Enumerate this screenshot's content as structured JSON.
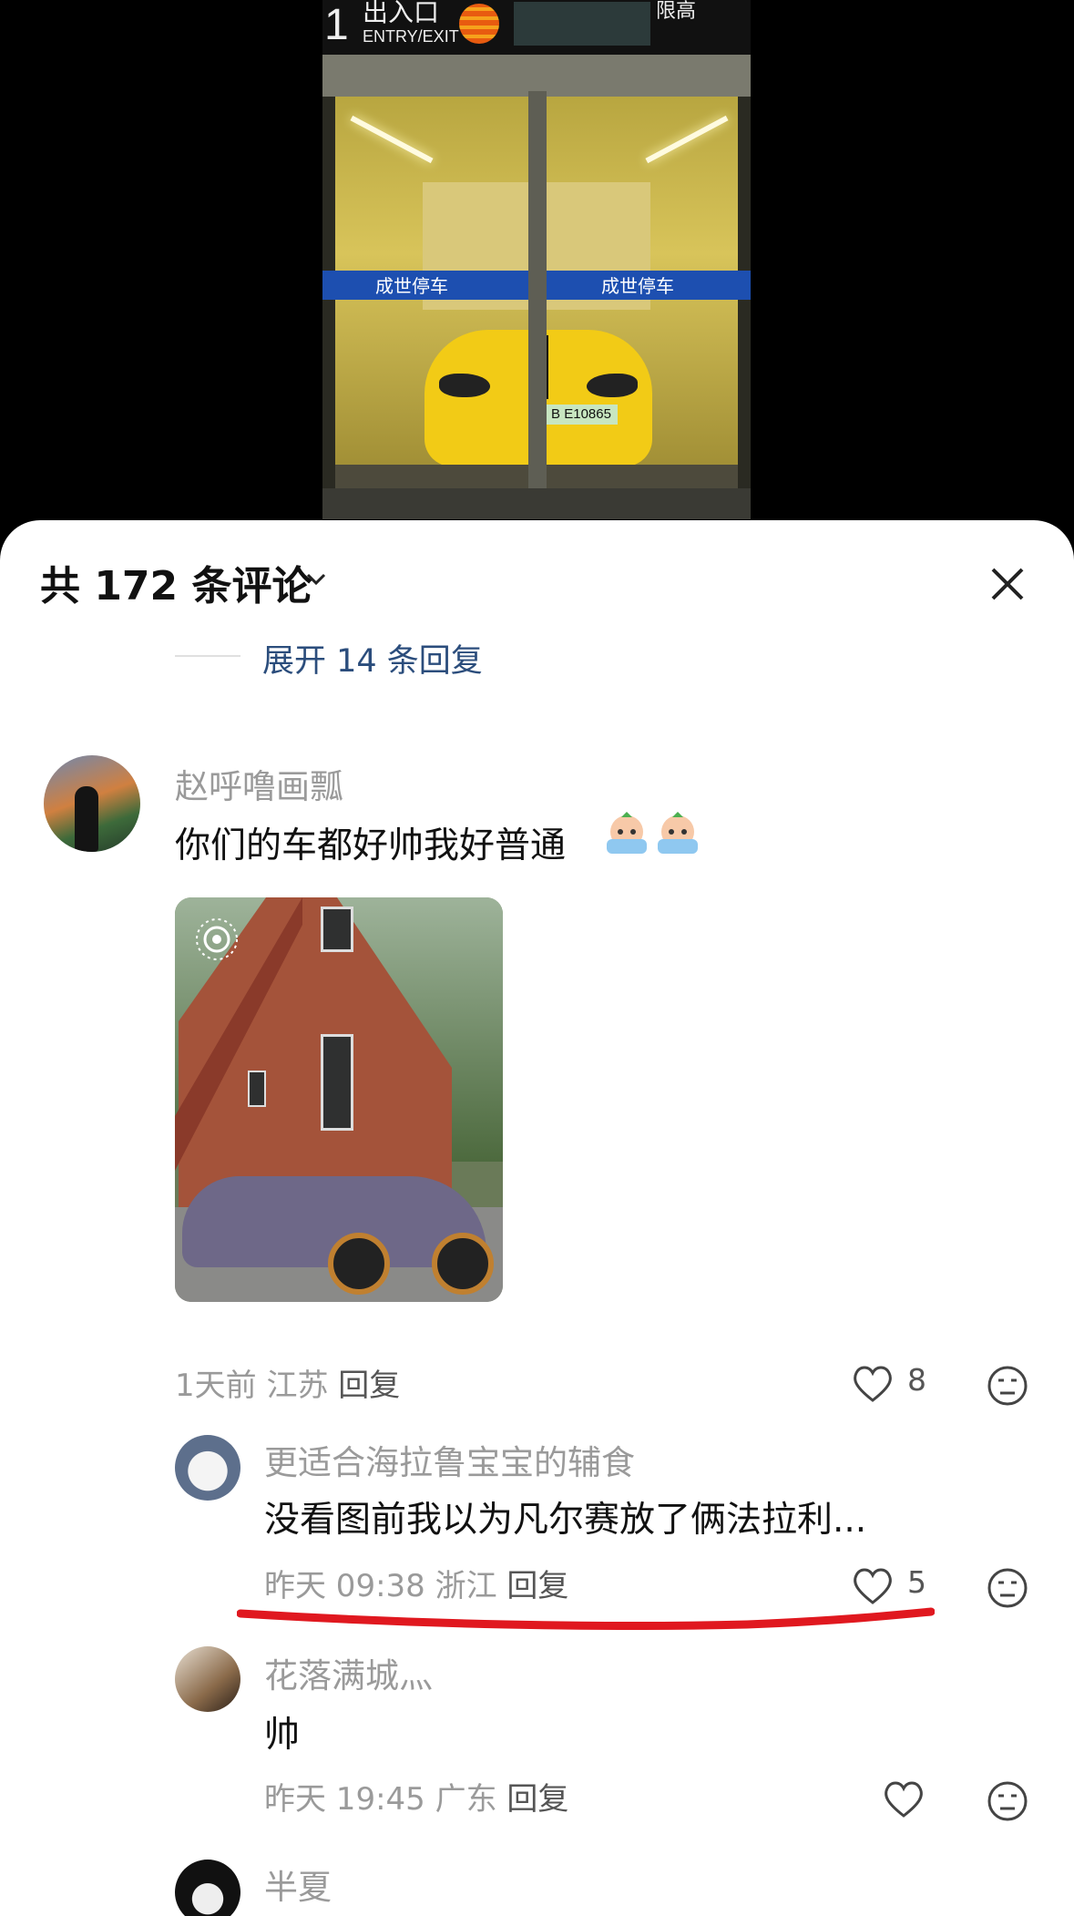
{
  "background_photo": {
    "sign_number": "1",
    "sign_cn": "出入口",
    "sign_en": "ENTRY/EXIT",
    "sign_limit": "限高",
    "banner_left": "成世停车",
    "banner_right": "成世停车",
    "plate": "B E10865"
  },
  "header": {
    "title": "共 172 条评论"
  },
  "expand_replies": "展开 14 条回复",
  "comments": [
    {
      "username": "赵呼噜画瓢",
      "text": "你们的车都好帅我好普通",
      "time": "1天前",
      "location": "江苏",
      "reply": "回复",
      "likes": "8"
    },
    {
      "username": "更适合海拉鲁宝宝的辅食",
      "text": "没看图前我以为凡尔赛放了俩法拉利...",
      "time": "昨天 09:38",
      "location": "浙江",
      "reply": "回复",
      "likes": "5"
    },
    {
      "username": "花落满城灬",
      "text": "帅",
      "time": "昨天 19:45",
      "location": "广东",
      "reply": "回复"
    },
    {
      "username": "半夏"
    }
  ],
  "colors": {
    "link_blue": "#2b4d7c",
    "annotation_red": "#e0181f",
    "muted_gray": "#9a9a9a"
  }
}
